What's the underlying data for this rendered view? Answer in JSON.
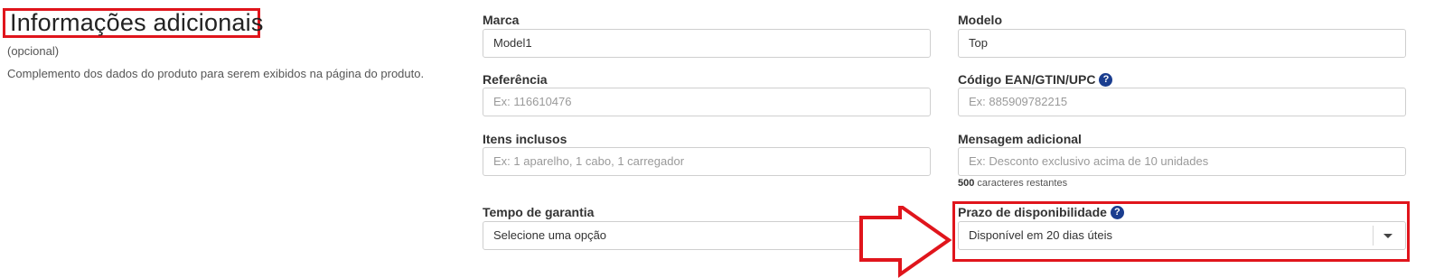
{
  "section": {
    "title": "Informações adicionais",
    "subtitle": "(opcional)",
    "description": "Complemento dos dados do produto para serem exibidos na página do produto."
  },
  "fields": {
    "marca": {
      "label": "Marca",
      "value": "Model1"
    },
    "modelo": {
      "label": "Modelo",
      "value": "Top"
    },
    "referencia": {
      "label": "Referência",
      "placeholder": "Ex: 116610476"
    },
    "ean": {
      "label": "Código EAN/GTIN/UPC",
      "placeholder": "Ex: 885909782215"
    },
    "itens": {
      "label": "Itens inclusos",
      "placeholder": "Ex: 1 aparelho, 1 cabo, 1 carregador"
    },
    "mensagem": {
      "label": "Mensagem adicional",
      "placeholder": "Ex: Desconto exclusivo acima de 10 unidades",
      "counter_value": "500",
      "counter_text": "caracteres restantes"
    },
    "garantia": {
      "label": "Tempo de garantia",
      "selected": "Selecione uma opção"
    },
    "prazo": {
      "label": "Prazo de disponibilidade",
      "selected": "Disponível em 20 dias úteis"
    }
  },
  "icons": {
    "help": "question-mark-icon",
    "caret": "chevron-down-icon",
    "arrow": "right-arrow-icon"
  },
  "colors": {
    "highlight": "#e0151c",
    "help_icon": "#1a3d8f",
    "border": "#cfcfcf"
  }
}
